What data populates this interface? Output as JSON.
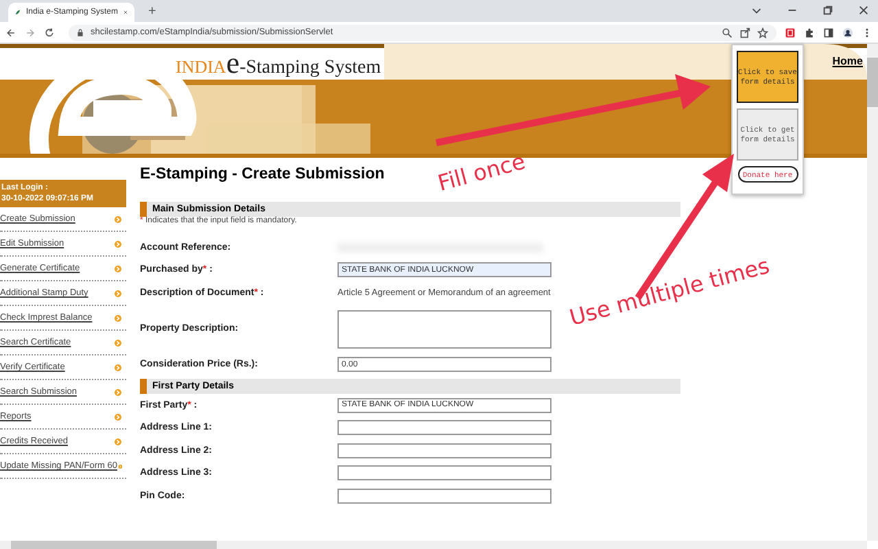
{
  "browser": {
    "tab_title": "India e-Stamping System",
    "new_tab": "+",
    "url": "shcilestamp.com/eStampIndia/submission/SubmissionServlet"
  },
  "header": {
    "logo_prefix": "INDIA",
    "logo_e": "e",
    "logo_suffix": "-Stamping System",
    "home_link": "Home"
  },
  "sidebar": {
    "login_label": "Last Login :",
    "login_time": "30-10-2022 09:07:16 PM",
    "items": [
      {
        "label": "Create Submission"
      },
      {
        "label": "Edit Submission"
      },
      {
        "label": "Generate Certificate"
      },
      {
        "label": "Additional Stamp Duty"
      },
      {
        "label": "Check Imprest Balance"
      },
      {
        "label": "Search Certificate"
      },
      {
        "label": "Verify Certificate"
      },
      {
        "label": "Search Submission"
      },
      {
        "label": "Reports"
      },
      {
        "label": "Credits Received"
      },
      {
        "label": "Update Missing PAN/Form 60"
      }
    ]
  },
  "page_title": "E-Stamping - Create Submission",
  "sections": [
    {
      "title": "Main Submission Details",
      "note_mark": "*",
      "note": "Indicates that the input field is mandatory.",
      "rows": [
        {
          "kind": "blurred",
          "label": "Account Reference:"
        },
        {
          "kind": "input",
          "label": "Purchased by",
          "required_mark": "*",
          "label_end": ":",
          "value": "STATE BANK OF INDIA LUCKNOW",
          "autofilled": true
        },
        {
          "kind": "static",
          "label": "Description of Document",
          "required_mark": "*",
          "label_end": ":",
          "value": "Article 5 Agreement or Memorandum of an agreement"
        },
        {
          "kind": "textarea",
          "label": "Property Description:"
        },
        {
          "kind": "input",
          "label": "Consideration Price (Rs.):",
          "value": "0.00",
          "autofilled": false
        }
      ]
    },
    {
      "title": "First Party Details",
      "rows": [
        {
          "kind": "input",
          "label": "First Party",
          "required_mark": "*",
          "label_end": ":",
          "value": "STATE BANK OF INDIA LUCKNOW",
          "autofilled": false
        },
        {
          "kind": "input",
          "label": "Address Line 1:",
          "autofilled": false
        },
        {
          "kind": "input",
          "label": "Address Line 2:",
          "autofilled": false
        },
        {
          "kind": "input",
          "label": "Address Line 3:",
          "autofilled": false
        },
        {
          "kind": "input",
          "label": "Pin Code:",
          "autofilled": false
        }
      ]
    }
  ],
  "popup": {
    "buttons": [
      {
        "label": "Click to save form details",
        "highlighted": true
      },
      {
        "label": "Click to get form details",
        "highlighted": false
      }
    ],
    "donate": "Donate here"
  },
  "annotations": [
    {
      "text": "Fill once"
    },
    {
      "text": "Use multiple times"
    }
  ]
}
